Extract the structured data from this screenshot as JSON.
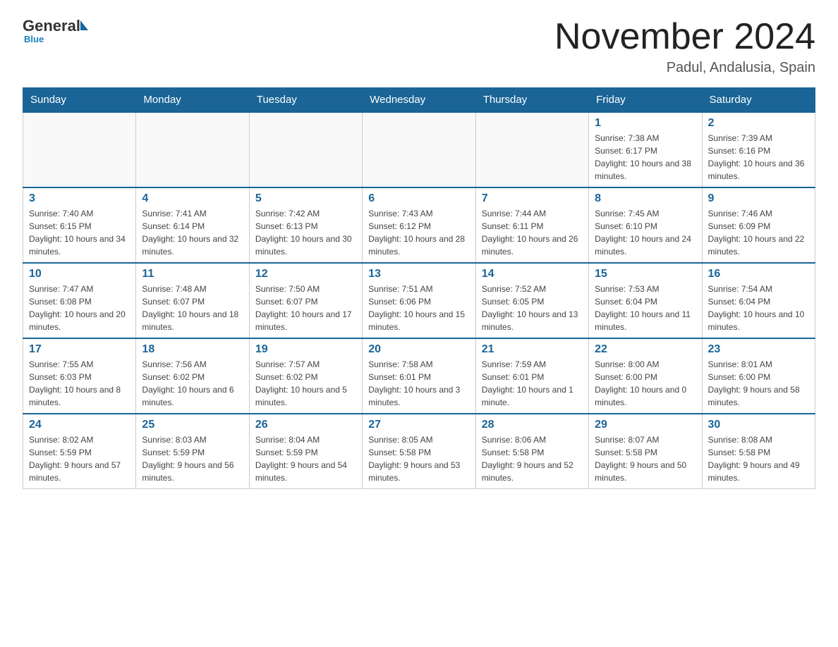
{
  "header": {
    "logo_general": "General",
    "logo_blue": "Blue",
    "month_title": "November 2024",
    "location": "Padul, Andalusia, Spain"
  },
  "days_of_week": [
    "Sunday",
    "Monday",
    "Tuesday",
    "Wednesday",
    "Thursday",
    "Friday",
    "Saturday"
  ],
  "weeks": [
    [
      {
        "day": "",
        "info": ""
      },
      {
        "day": "",
        "info": ""
      },
      {
        "day": "",
        "info": ""
      },
      {
        "day": "",
        "info": ""
      },
      {
        "day": "",
        "info": ""
      },
      {
        "day": "1",
        "info": "Sunrise: 7:38 AM\nSunset: 6:17 PM\nDaylight: 10 hours and 38 minutes."
      },
      {
        "day": "2",
        "info": "Sunrise: 7:39 AM\nSunset: 6:16 PM\nDaylight: 10 hours and 36 minutes."
      }
    ],
    [
      {
        "day": "3",
        "info": "Sunrise: 7:40 AM\nSunset: 6:15 PM\nDaylight: 10 hours and 34 minutes."
      },
      {
        "day": "4",
        "info": "Sunrise: 7:41 AM\nSunset: 6:14 PM\nDaylight: 10 hours and 32 minutes."
      },
      {
        "day": "5",
        "info": "Sunrise: 7:42 AM\nSunset: 6:13 PM\nDaylight: 10 hours and 30 minutes."
      },
      {
        "day": "6",
        "info": "Sunrise: 7:43 AM\nSunset: 6:12 PM\nDaylight: 10 hours and 28 minutes."
      },
      {
        "day": "7",
        "info": "Sunrise: 7:44 AM\nSunset: 6:11 PM\nDaylight: 10 hours and 26 minutes."
      },
      {
        "day": "8",
        "info": "Sunrise: 7:45 AM\nSunset: 6:10 PM\nDaylight: 10 hours and 24 minutes."
      },
      {
        "day": "9",
        "info": "Sunrise: 7:46 AM\nSunset: 6:09 PM\nDaylight: 10 hours and 22 minutes."
      }
    ],
    [
      {
        "day": "10",
        "info": "Sunrise: 7:47 AM\nSunset: 6:08 PM\nDaylight: 10 hours and 20 minutes."
      },
      {
        "day": "11",
        "info": "Sunrise: 7:48 AM\nSunset: 6:07 PM\nDaylight: 10 hours and 18 minutes."
      },
      {
        "day": "12",
        "info": "Sunrise: 7:50 AM\nSunset: 6:07 PM\nDaylight: 10 hours and 17 minutes."
      },
      {
        "day": "13",
        "info": "Sunrise: 7:51 AM\nSunset: 6:06 PM\nDaylight: 10 hours and 15 minutes."
      },
      {
        "day": "14",
        "info": "Sunrise: 7:52 AM\nSunset: 6:05 PM\nDaylight: 10 hours and 13 minutes."
      },
      {
        "day": "15",
        "info": "Sunrise: 7:53 AM\nSunset: 6:04 PM\nDaylight: 10 hours and 11 minutes."
      },
      {
        "day": "16",
        "info": "Sunrise: 7:54 AM\nSunset: 6:04 PM\nDaylight: 10 hours and 10 minutes."
      }
    ],
    [
      {
        "day": "17",
        "info": "Sunrise: 7:55 AM\nSunset: 6:03 PM\nDaylight: 10 hours and 8 minutes."
      },
      {
        "day": "18",
        "info": "Sunrise: 7:56 AM\nSunset: 6:02 PM\nDaylight: 10 hours and 6 minutes."
      },
      {
        "day": "19",
        "info": "Sunrise: 7:57 AM\nSunset: 6:02 PM\nDaylight: 10 hours and 5 minutes."
      },
      {
        "day": "20",
        "info": "Sunrise: 7:58 AM\nSunset: 6:01 PM\nDaylight: 10 hours and 3 minutes."
      },
      {
        "day": "21",
        "info": "Sunrise: 7:59 AM\nSunset: 6:01 PM\nDaylight: 10 hours and 1 minute."
      },
      {
        "day": "22",
        "info": "Sunrise: 8:00 AM\nSunset: 6:00 PM\nDaylight: 10 hours and 0 minutes."
      },
      {
        "day": "23",
        "info": "Sunrise: 8:01 AM\nSunset: 6:00 PM\nDaylight: 9 hours and 58 minutes."
      }
    ],
    [
      {
        "day": "24",
        "info": "Sunrise: 8:02 AM\nSunset: 5:59 PM\nDaylight: 9 hours and 57 minutes."
      },
      {
        "day": "25",
        "info": "Sunrise: 8:03 AM\nSunset: 5:59 PM\nDaylight: 9 hours and 56 minutes."
      },
      {
        "day": "26",
        "info": "Sunrise: 8:04 AM\nSunset: 5:59 PM\nDaylight: 9 hours and 54 minutes."
      },
      {
        "day": "27",
        "info": "Sunrise: 8:05 AM\nSunset: 5:58 PM\nDaylight: 9 hours and 53 minutes."
      },
      {
        "day": "28",
        "info": "Sunrise: 8:06 AM\nSunset: 5:58 PM\nDaylight: 9 hours and 52 minutes."
      },
      {
        "day": "29",
        "info": "Sunrise: 8:07 AM\nSunset: 5:58 PM\nDaylight: 9 hours and 50 minutes."
      },
      {
        "day": "30",
        "info": "Sunrise: 8:08 AM\nSunset: 5:58 PM\nDaylight: 9 hours and 49 minutes."
      }
    ]
  ]
}
